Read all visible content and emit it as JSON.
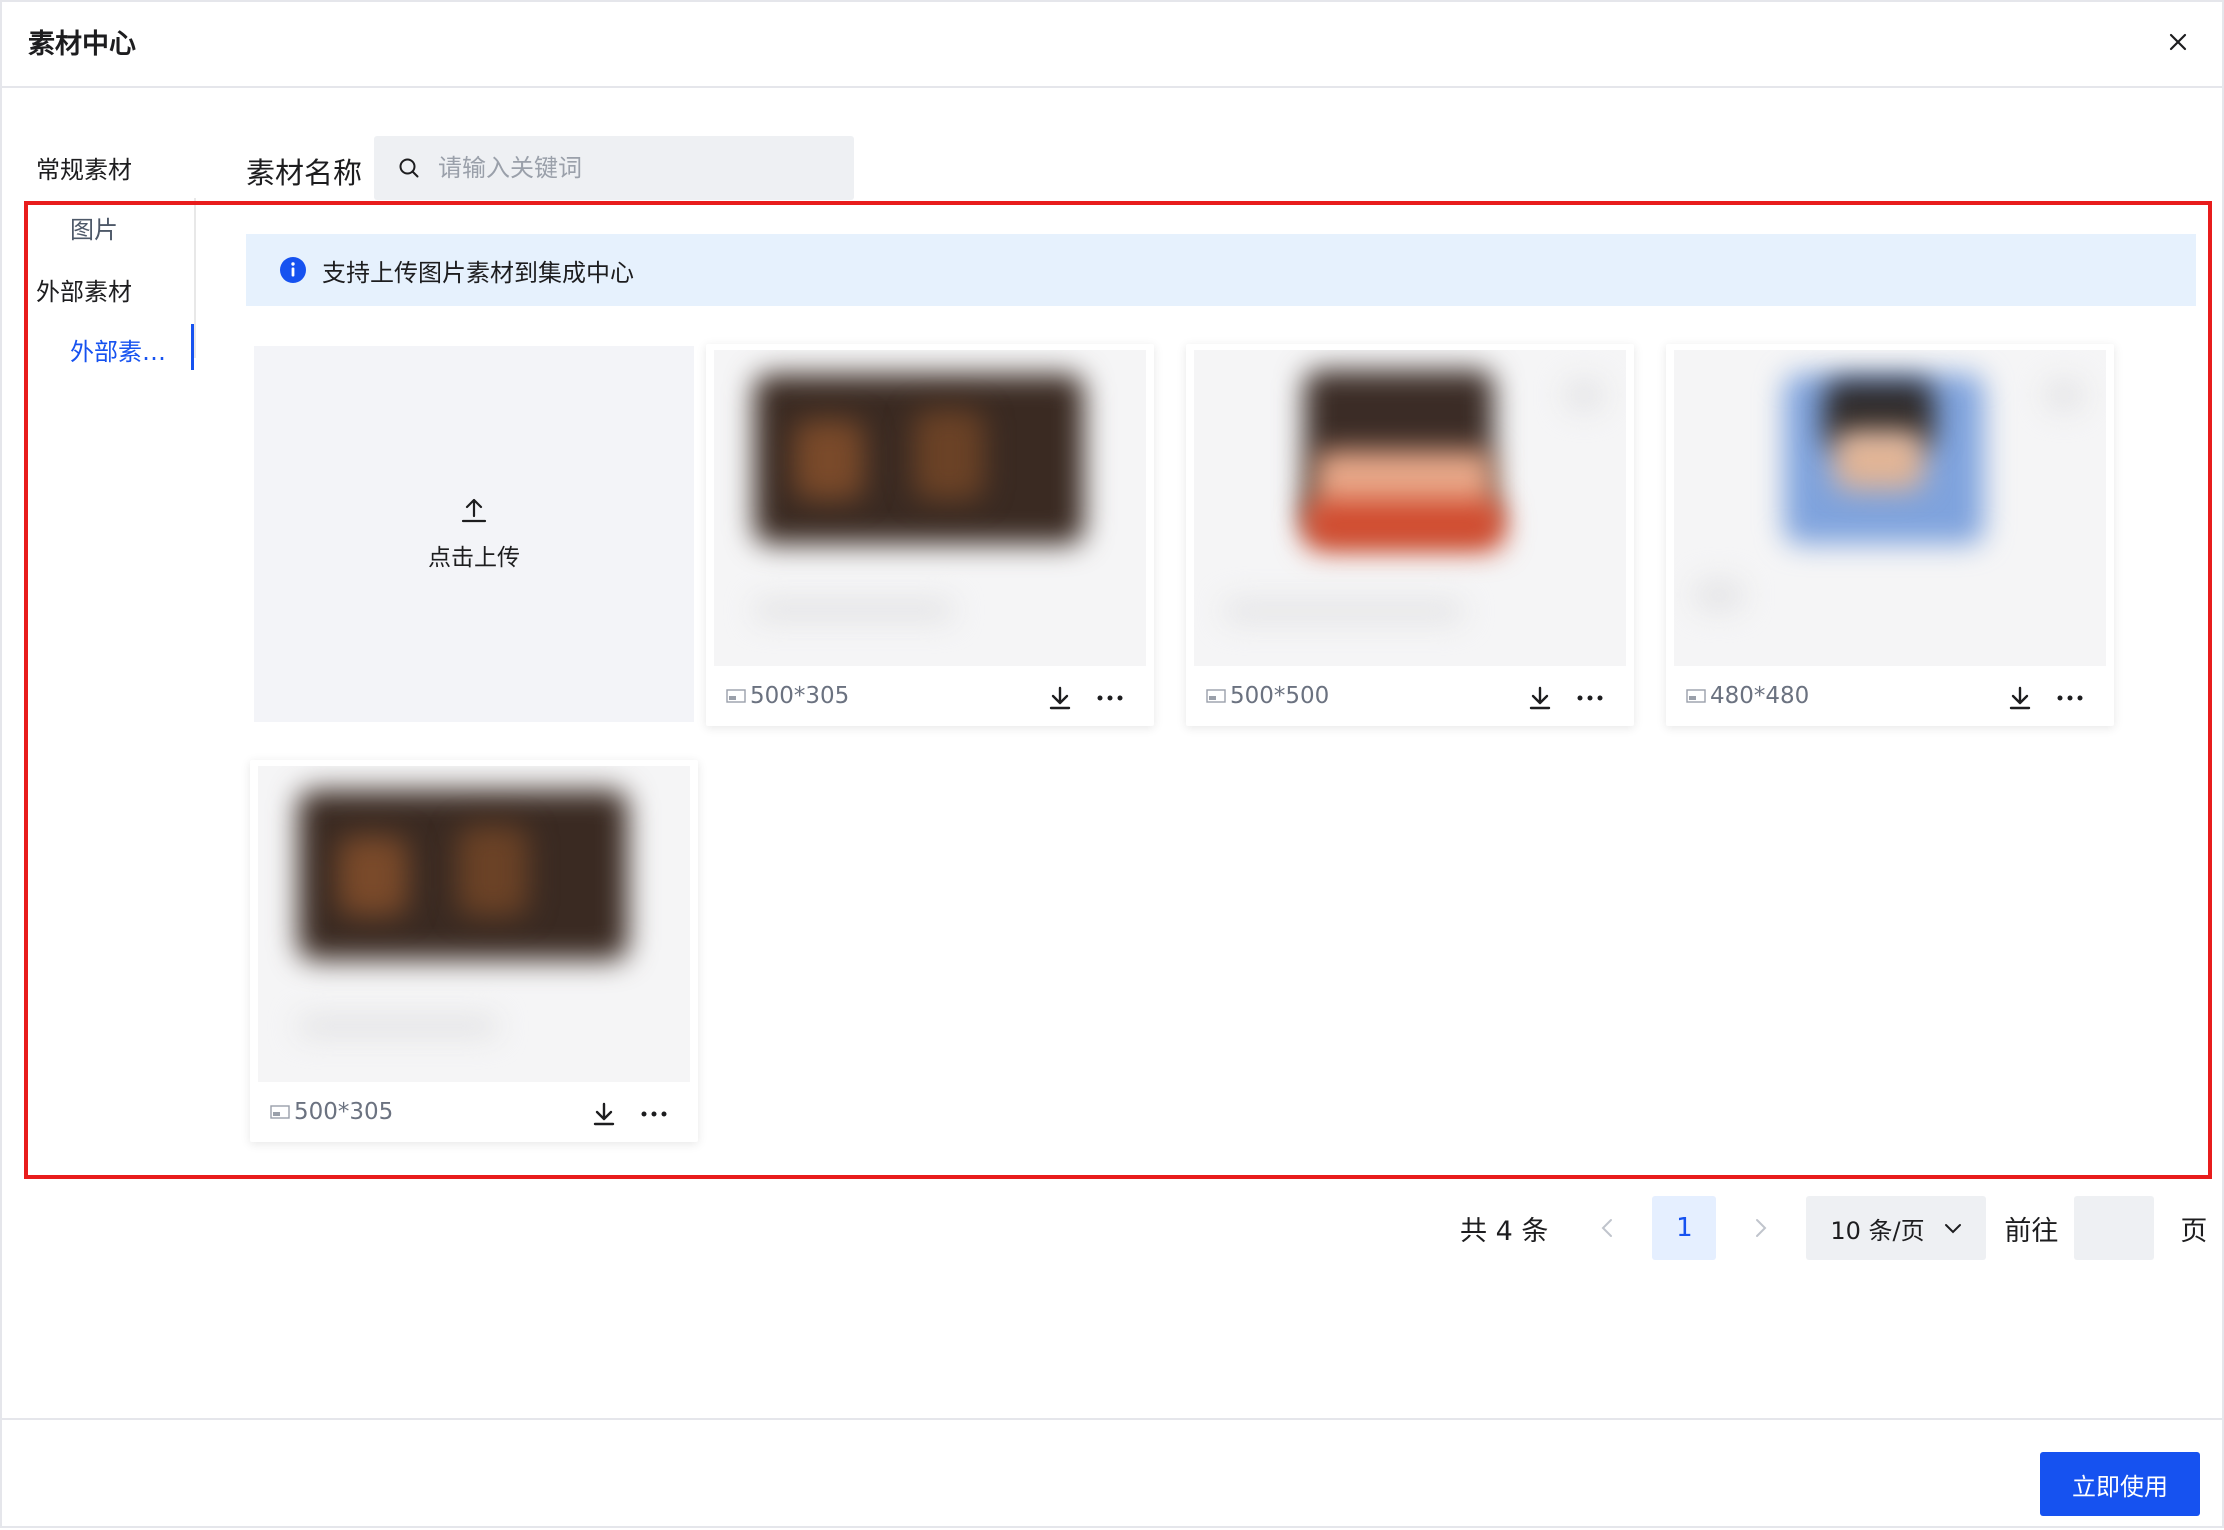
{
  "dialog": {
    "title": "素材中心",
    "close_icon": "close-icon"
  },
  "sidebar": {
    "groups": [
      {
        "label": "常规素材",
        "items": [
          {
            "label": "图片",
            "active": false
          }
        ]
      },
      {
        "label": "外部素材",
        "items": [
          {
            "label": "外部素…",
            "active": true
          }
        ]
      }
    ],
    "active_color": "#1652f0"
  },
  "search": {
    "label": "素材名称",
    "placeholder": "请输入关键词",
    "value": "",
    "icon": "search-icon"
  },
  "notice": {
    "icon": "info-icon",
    "text": "支持上传图片素材到集成中心"
  },
  "upload": {
    "icon": "upload-icon",
    "label": "点击上传"
  },
  "materials": [
    {
      "size": "500*305",
      "thumb": "dark-banner"
    },
    {
      "size": "500*500",
      "thumb": "portrait-warm"
    },
    {
      "size": "480*480",
      "thumb": "portrait-blue"
    },
    {
      "size": "500*305",
      "thumb": "dark-banner"
    }
  ],
  "card_actions": {
    "download_icon": "download-icon",
    "more_icon": "more-icon"
  },
  "pagination": {
    "total": "共 4 条",
    "current_page": "1",
    "page_size": "10 条/页",
    "goto_label": "前往",
    "goto_value": "",
    "page_unit": "页"
  },
  "footer": {
    "primary_label": "立即使用"
  },
  "colors": {
    "primary": "#1652f0",
    "highlight": "#e81c1c",
    "notice_bg": "#e6f1fd"
  }
}
